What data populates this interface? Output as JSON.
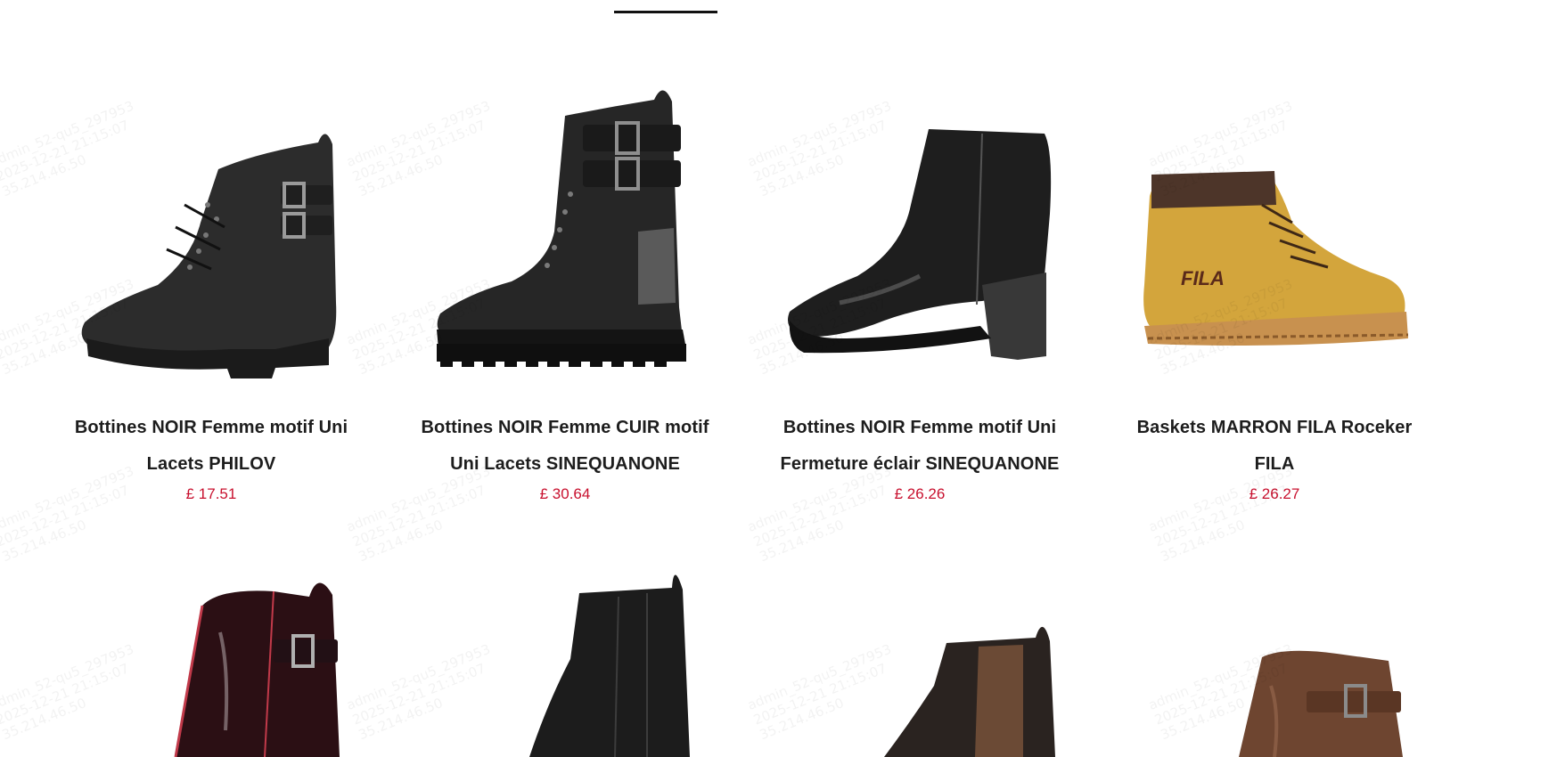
{
  "products_row1": [
    {
      "title_line1": "Bottines NOIR Femme motif Uni",
      "title_line2": "Lacets PHILOV",
      "price": "£ 17.51"
    },
    {
      "title_line1": "Bottines NOIR Femme CUIR motif",
      "title_line2": "Uni Lacets SINEQUANONE",
      "price": "£ 30.64"
    },
    {
      "title_line1": "Bottines NOIR Femme motif Uni",
      "title_line2": "Fermeture éclair SINEQUANONE",
      "price": "£ 26.26"
    },
    {
      "title_line1": "Baskets MARRON FILA Roceker",
      "title_line2": "FILA",
      "price": "£ 26.27"
    }
  ],
  "brand_print": "FILA",
  "watermark": {
    "line1": "admin_52-qu5_297953",
    "line2": "2025-12-21 21:15:07",
    "line3": "35.214.46.50"
  },
  "colors": {
    "price": "#c8102e",
    "title": "#1d1d1d",
    "tab_underline": "#111111"
  },
  "icons": {
    "boot_1": "lace-up-buckle-boot-black",
    "boot_2": "combat-boot-double-buckle-black",
    "boot_3": "heeled-ankle-boot-black",
    "boot_4": "work-boot-mustard",
    "boot_5": "patent-buckle-boot-burgundy",
    "boot_6": "chelsea-boot-black",
    "boot_7": "chelsea-boot-brown",
    "boot_8": "buckle-ankle-boot-brown"
  }
}
